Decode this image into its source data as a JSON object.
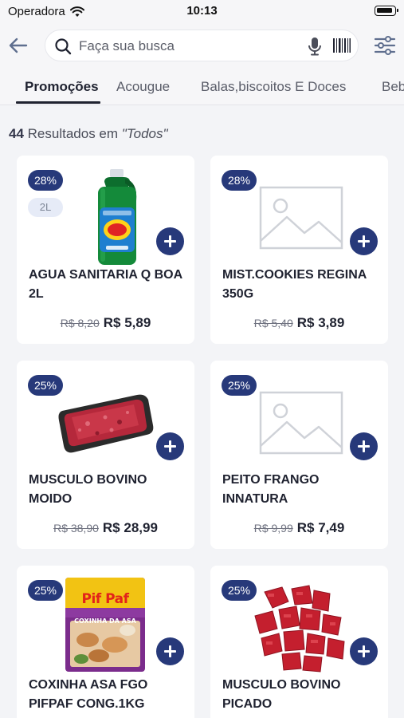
{
  "status_bar": {
    "carrier": "Operadora",
    "time": "10:13"
  },
  "header": {
    "search_placeholder": "Faça sua busca"
  },
  "tabs": [
    {
      "label": "Promoções",
      "active": true
    },
    {
      "label": "Acougue",
      "active": false
    },
    {
      "label": "Balas,biscoitos E Doces",
      "active": false
    },
    {
      "label": "Beb",
      "active": false
    }
  ],
  "results": {
    "count": "44",
    "text": "Resultados em ",
    "category": "\"Todos\""
  },
  "products": [
    {
      "discount": "28%",
      "size": "2L",
      "name": "AGUA SANITARIA Q BOA 2L",
      "old_price": "R$ 8,20",
      "price": "R$ 5,89",
      "image": "bleach-bottle"
    },
    {
      "discount": "28%",
      "name": "MIST.COOKIES REGINA 350G",
      "old_price": "R$ 5,40",
      "price": "R$ 3,89",
      "image": "placeholder"
    },
    {
      "discount": "25%",
      "name": "MUSCULO BOVINO MOIDO",
      "old_price": "R$ 38,90",
      "price": "R$ 28,99",
      "image": "ground-beef-tray"
    },
    {
      "discount": "25%",
      "name": "PEITO FRANGO INNATURA",
      "old_price": "R$ 9,99",
      "price": "R$ 7,49",
      "image": "placeholder"
    },
    {
      "discount": "25%",
      "name": "COXINHA ASA FGO PIFPAF CONG.1KG",
      "old_price": "",
      "price": "",
      "image": "pifpaf-bag",
      "package": {
        "brand": "Pif Paf",
        "product": "COXINHA DA ASA"
      }
    },
    {
      "discount": "25%",
      "name": "MUSCULO BOVINO PICADO",
      "old_price": "",
      "price": "",
      "image": "diced-beef"
    }
  ],
  "colors": {
    "brand": "#27397a",
    "background": "#f3f4f7",
    "card": "#ffffff"
  }
}
